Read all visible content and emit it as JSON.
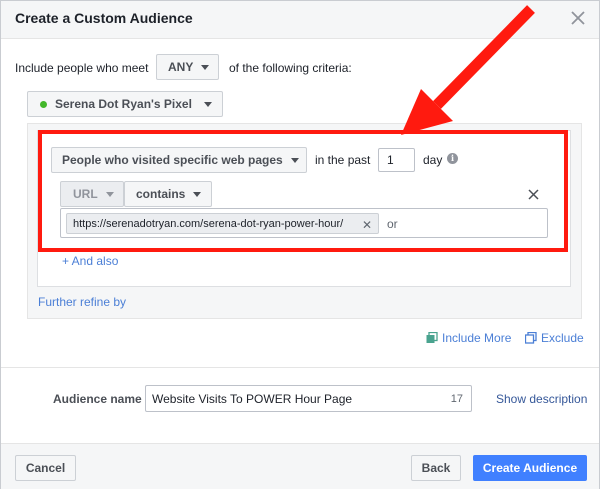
{
  "dialog": {
    "title": "Create a Custom Audience"
  },
  "criteria": {
    "include_prefix": "Include people who meet",
    "match_value": "ANY",
    "include_suffix": "of the following criteria:"
  },
  "pixel": {
    "label": "Serena Dot Ryan's Pixel",
    "status_color": "#42b72a"
  },
  "rule": {
    "visitor_type": "People who visited specific web pages",
    "in_the_past_label": "in the past",
    "days_value": "1",
    "day_label": "day",
    "url_label": "URL",
    "operator": "contains",
    "url_token": "https://serenadotryan.com/serena-dot-ryan-power-hour/",
    "or_label": "or",
    "and_also": "+ And also",
    "further_refine": "Further refine by"
  },
  "actions": {
    "include_more": "Include More",
    "exclude": "Exclude"
  },
  "audience": {
    "name_label": "Audience name",
    "name_value": "Website Visits To POWER Hour Page",
    "char_count": "17",
    "show_description": "Show description"
  },
  "footer": {
    "cancel": "Cancel",
    "back": "Back",
    "create": "Create Audience"
  },
  "colors": {
    "highlight_red": "#ff1a0f",
    "primary_blue": "#4080ff",
    "link_blue": "#365899"
  }
}
